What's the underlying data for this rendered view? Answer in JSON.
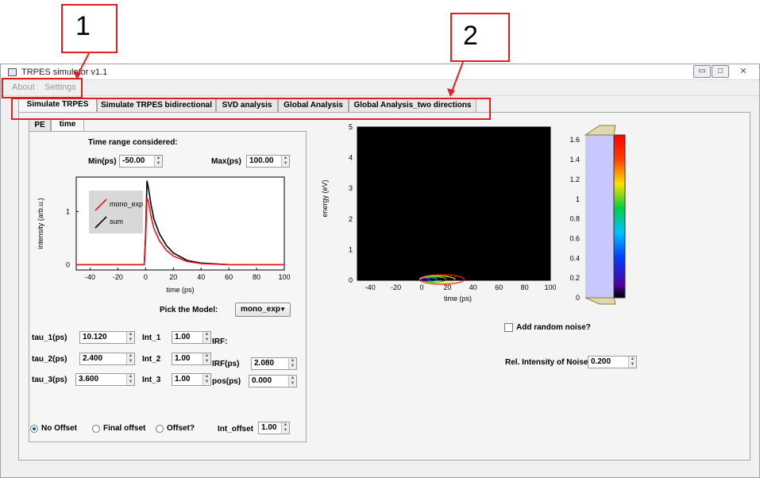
{
  "annotations": {
    "label_1": "1",
    "label_2": "2"
  },
  "window": {
    "title": "TRPES simulator v1.1",
    "controls": {
      "minimize": "▭",
      "maximize": "□",
      "close": "✕"
    }
  },
  "menu": {
    "items": [
      "About",
      "Settings"
    ]
  },
  "tabs": [
    "Simulate TRPES",
    "Simulate TRPES bidirectional",
    "SVD analysis",
    "Global Analysis",
    "Global Analysis_two directions"
  ],
  "subtabs": [
    "PE",
    "time"
  ],
  "time_panel": {
    "heading": "Time range considered:",
    "min_label": "Min(ps)",
    "min_value": "-50.00",
    "max_label": "Max(ps)",
    "max_value": "100.00",
    "pick_model_label": "Pick the Model:",
    "model_value": "mono_exp",
    "tau1_label": "tau_1(ps)",
    "tau1_value": "10.120",
    "tau2_label": "tau_2(ps)",
    "tau2_value": "2.400",
    "tau3_label": "tau_3(ps)",
    "tau3_value": "3.600",
    "int1_label": "Int_1",
    "int1_value": "1.00",
    "int2_label": "Int_2",
    "int2_value": "1.00",
    "int3_label": "Int_3",
    "int3_value": "1.00",
    "irf_heading": "IRF:",
    "irf_label": "IRF(ps)",
    "irf_value": "2.080",
    "pos_label": "pos(ps)",
    "pos_value": "0.000",
    "radio_no_offset": "No Offset",
    "radio_final_offset": "Final offset",
    "radio_offset": "Offset?",
    "int_offset_label": "Int_offset",
    "int_offset_value": "1.00"
  },
  "noise": {
    "checkbox_label": "Add random noise?",
    "rel_label": "Rel. Intensity of Noise",
    "rel_value": "0.200"
  },
  "chart_data": [
    {
      "type": "line",
      "xlabel": "time (ps)",
      "ylabel": "intensity (arb.u.)",
      "xlim": [
        -50,
        100
      ],
      "ylim": [
        -0.1,
        1.65
      ],
      "xticks": [
        "-40",
        "-20",
        "0",
        "20",
        "40",
        "60",
        "80",
        "100"
      ],
      "yticks": [
        "0",
        "1"
      ],
      "legend": "top-left",
      "series": [
        {
          "name": "mono_exp",
          "color": "#e8141c",
          "x": [
            -50,
            -1,
            0,
            1,
            2,
            4,
            6,
            10,
            15,
            20,
            30,
            40,
            60,
            100
          ],
          "y": [
            0,
            0,
            0.45,
            1.25,
            1.2,
            0.9,
            0.68,
            0.45,
            0.27,
            0.16,
            0.06,
            0.02,
            0.0,
            0
          ]
        },
        {
          "name": "sum",
          "color": "#000000",
          "x": [
            -50,
            -1,
            0,
            1,
            2,
            4,
            6,
            10,
            15,
            20,
            30,
            40,
            60,
            100
          ],
          "y": [
            0,
            0,
            0.55,
            1.58,
            1.45,
            1.12,
            0.86,
            0.58,
            0.36,
            0.22,
            0.08,
            0.03,
            0.0,
            0
          ]
        }
      ]
    },
    {
      "type": "heatmap",
      "xlabel": "time (ps)",
      "ylabel": "energy (eV)",
      "xlim": [
        -50,
        100
      ],
      "ylim": [
        0,
        5
      ],
      "xticks": [
        "-40",
        "-20",
        "0",
        "20",
        "40",
        "60",
        "80",
        "100"
      ],
      "yticks": [
        "0",
        "1",
        "2",
        "3",
        "4",
        "5"
      ],
      "colorbar_ticks": [
        "0",
        "0.2",
        "0.4",
        "0.6",
        "0.8",
        "1",
        "1.2",
        "1.4",
        "1.6"
      ],
      "colorbar_range": [
        0,
        1.65
      ]
    }
  ]
}
